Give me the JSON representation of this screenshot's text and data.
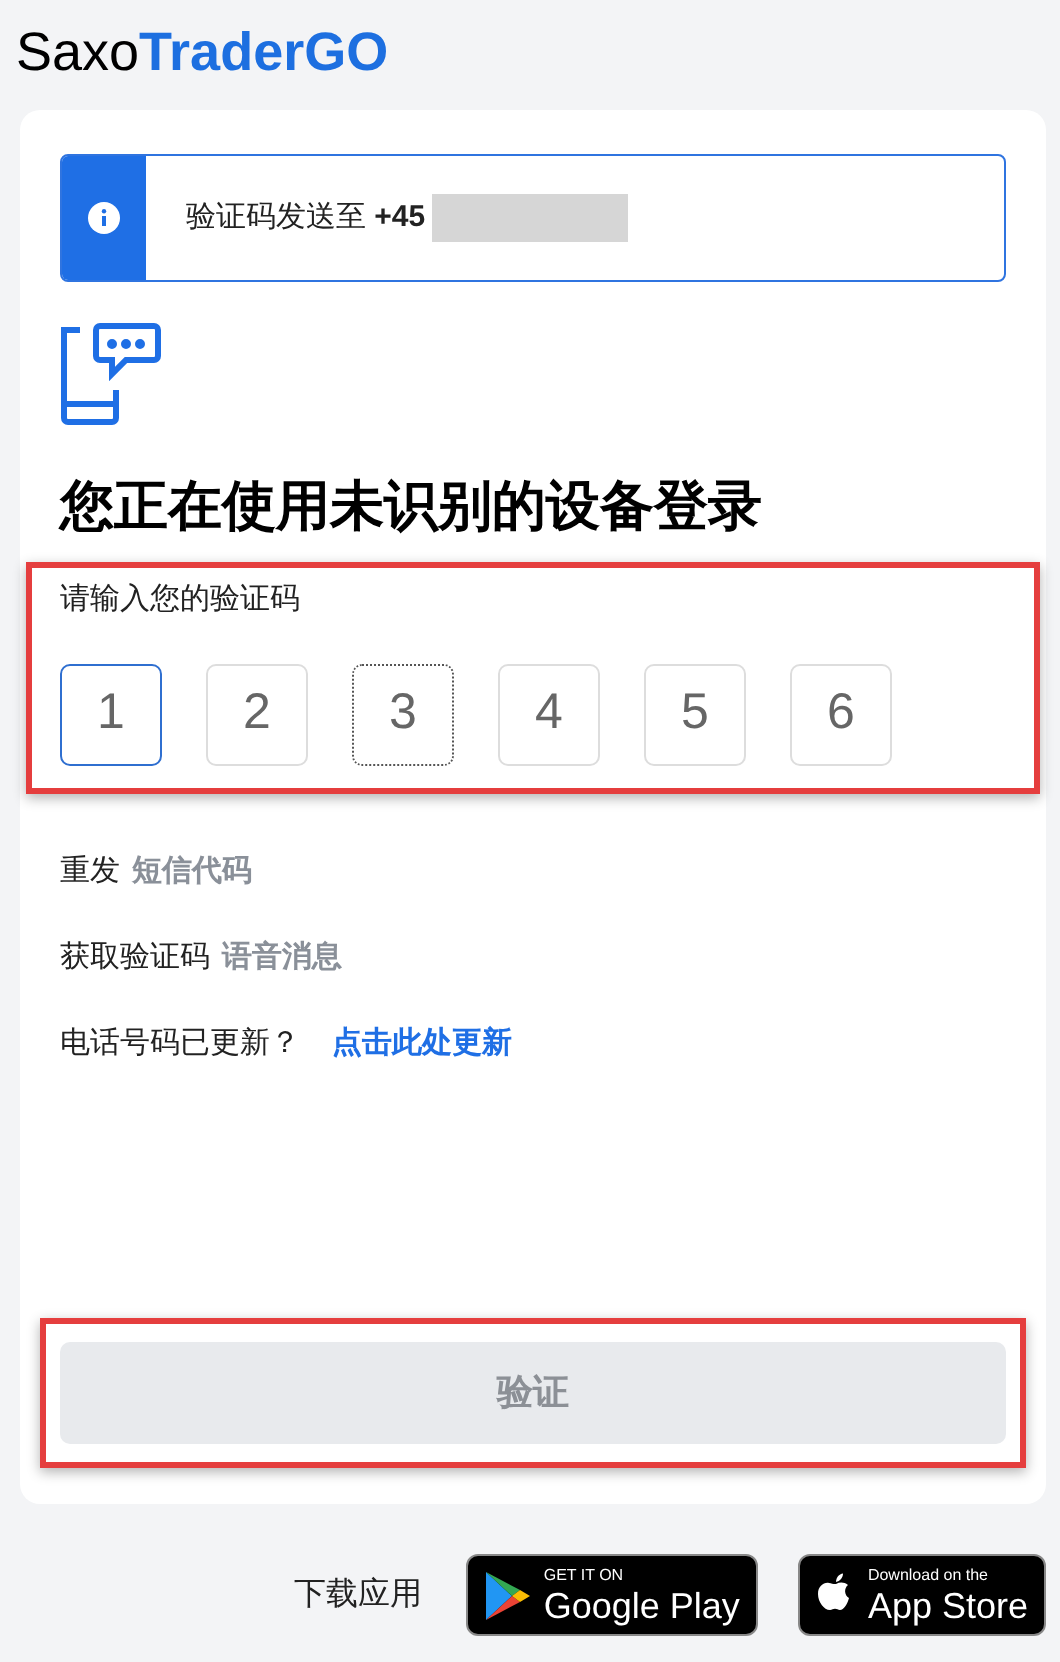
{
  "brand": {
    "part_1": "Saxo",
    "part_2": "TraderGO"
  },
  "notice": {
    "text": "验证码发送至 **+45**",
    "redacted": true
  },
  "title": "您正在使用未识别的设备登录",
  "code_section": {
    "label": "请输入您的验证码",
    "highlighted": true,
    "digits": [
      {
        "value": "1",
        "selected": true,
        "dotted": false
      },
      {
        "value": "2",
        "selected": false,
        "dotted": false
      },
      {
        "value": "3",
        "selected": false,
        "dotted": true
      },
      {
        "value": "4",
        "selected": false,
        "dotted": false
      },
      {
        "value": "5",
        "selected": false,
        "dotted": false
      },
      {
        "value": "6",
        "selected": false,
        "dotted": false
      }
    ]
  },
  "links": [
    {
      "prefix": "重发",
      "link": "短信代码",
      "kind": "muted"
    },
    {
      "prefix": "获取验证码",
      "link": "语音消息",
      "kind": "muted"
    },
    {
      "prefix": "电话号码已更新？",
      "link": "点击此处更新",
      "kind": "primary"
    }
  ],
  "verify_button": {
    "label": "验证",
    "disabled": true,
    "highlighted": true
  },
  "footer": {
    "label": "下载应用",
    "stores": [
      {
        "kind": "google",
        "small": "GET IT ON",
        "big": "Google Play"
      },
      {
        "kind": "apple",
        "small": "Download on the",
        "big": "App Store"
      }
    ]
  }
}
